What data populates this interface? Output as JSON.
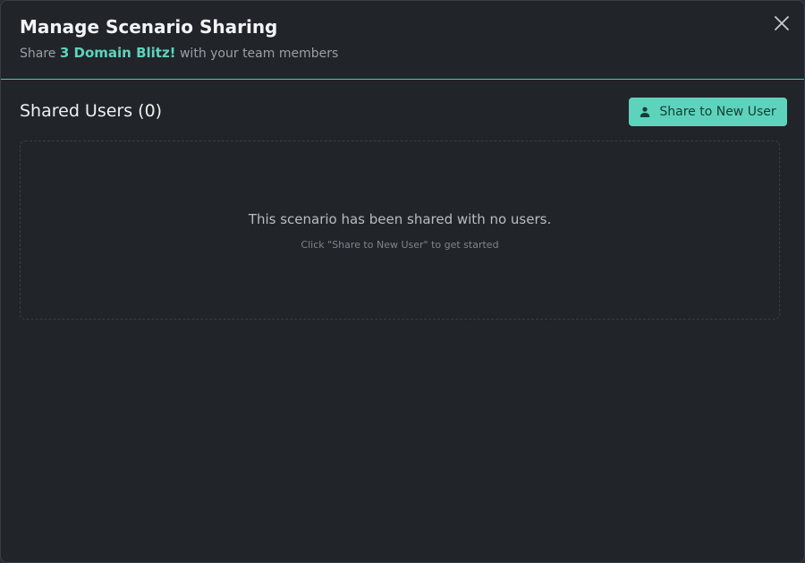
{
  "dialog": {
    "title": "Manage Scenario Sharing",
    "subtitle_prefix": "Share",
    "scenario_name": "3 Domain Blitz!",
    "subtitle_suffix": "with your team members",
    "close_icon": "close-icon"
  },
  "shared_users": {
    "section_title": "Shared Users (0)",
    "share_button_label": "Share to New User",
    "share_button_icon": "user-icon",
    "empty_message": "This scenario has been shared with no users.",
    "empty_hint": "Click \"Share to New User\" to get started"
  },
  "colors": {
    "accent": "#5ed3bc",
    "background": "#212429",
    "divider": "#4fc7b0"
  }
}
